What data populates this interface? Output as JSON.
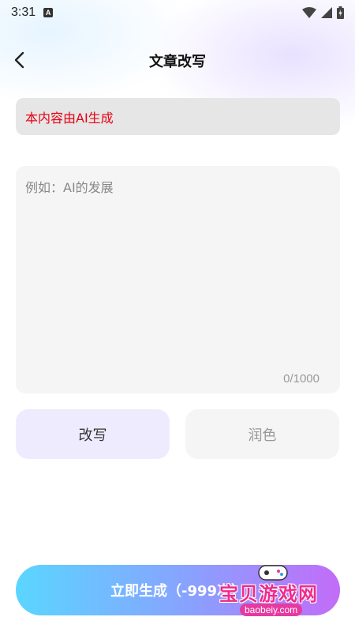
{
  "status_bar": {
    "time": "3:31",
    "notification_icon": "a-icon",
    "wifi_icon": "wifi-icon",
    "signal_icon": "signal-icon",
    "battery_icon": "battery-icon"
  },
  "header": {
    "back_icon": "back-arrow-icon",
    "title": "文章改写"
  },
  "notice": {
    "text": "本内容由AI生成",
    "color": "#e60012"
  },
  "input": {
    "placeholder": "例如：AI的发展",
    "value": "",
    "counter": "0/1000"
  },
  "modes": [
    {
      "label": "改写",
      "selected": true
    },
    {
      "label": "润色",
      "selected": false
    }
  ],
  "generate": {
    "label": "立即生成（-999次）"
  },
  "watermark": {
    "text": "宝贝游戏网",
    "url": "baobeiy.com"
  },
  "colors": {
    "accent_gradient_start": "#5ad6ff",
    "accent_gradient_end": "#c26cf8",
    "selected_mode_bg": "#efebff"
  }
}
